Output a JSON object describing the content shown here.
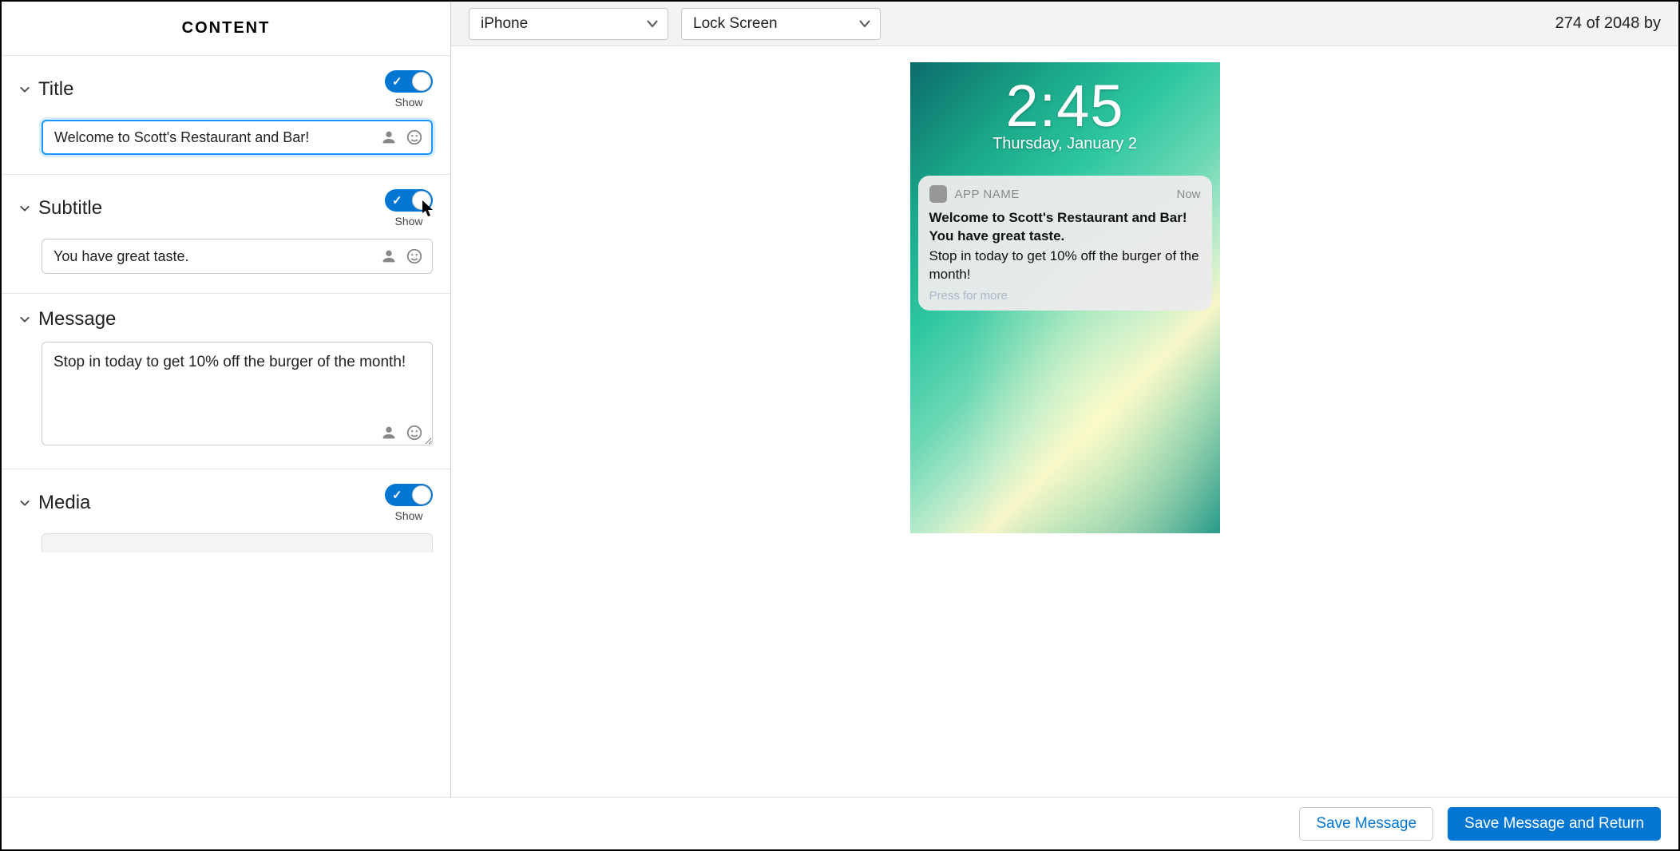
{
  "left": {
    "header": "CONTENT",
    "title": {
      "label": "Title",
      "show_label": "Show",
      "value": "Welcome to Scott's Restaurant and Bar!"
    },
    "subtitle": {
      "label": "Subtitle",
      "show_label": "Show",
      "value": "You have great taste."
    },
    "message": {
      "label": "Message",
      "value": "Stop in today to get 10% off the burger of the month!"
    },
    "media": {
      "label": "Media",
      "show_label": "Show"
    }
  },
  "right": {
    "device_select": "iPhone",
    "screen_select": "Lock Screen",
    "char_count": "274 of 2048 by"
  },
  "preview": {
    "time": "2:45",
    "date": "Thursday, January 2",
    "app_name": "APP NAME",
    "when": "Now",
    "title": "Welcome to Scott's Restaurant and Bar!",
    "subtitle": "You have great taste.",
    "message": "Stop in today to get 10% off the burger of the month!",
    "press_more": "Press for more"
  },
  "footer": {
    "save": "Save Message",
    "save_return": "Save Message and Return"
  }
}
